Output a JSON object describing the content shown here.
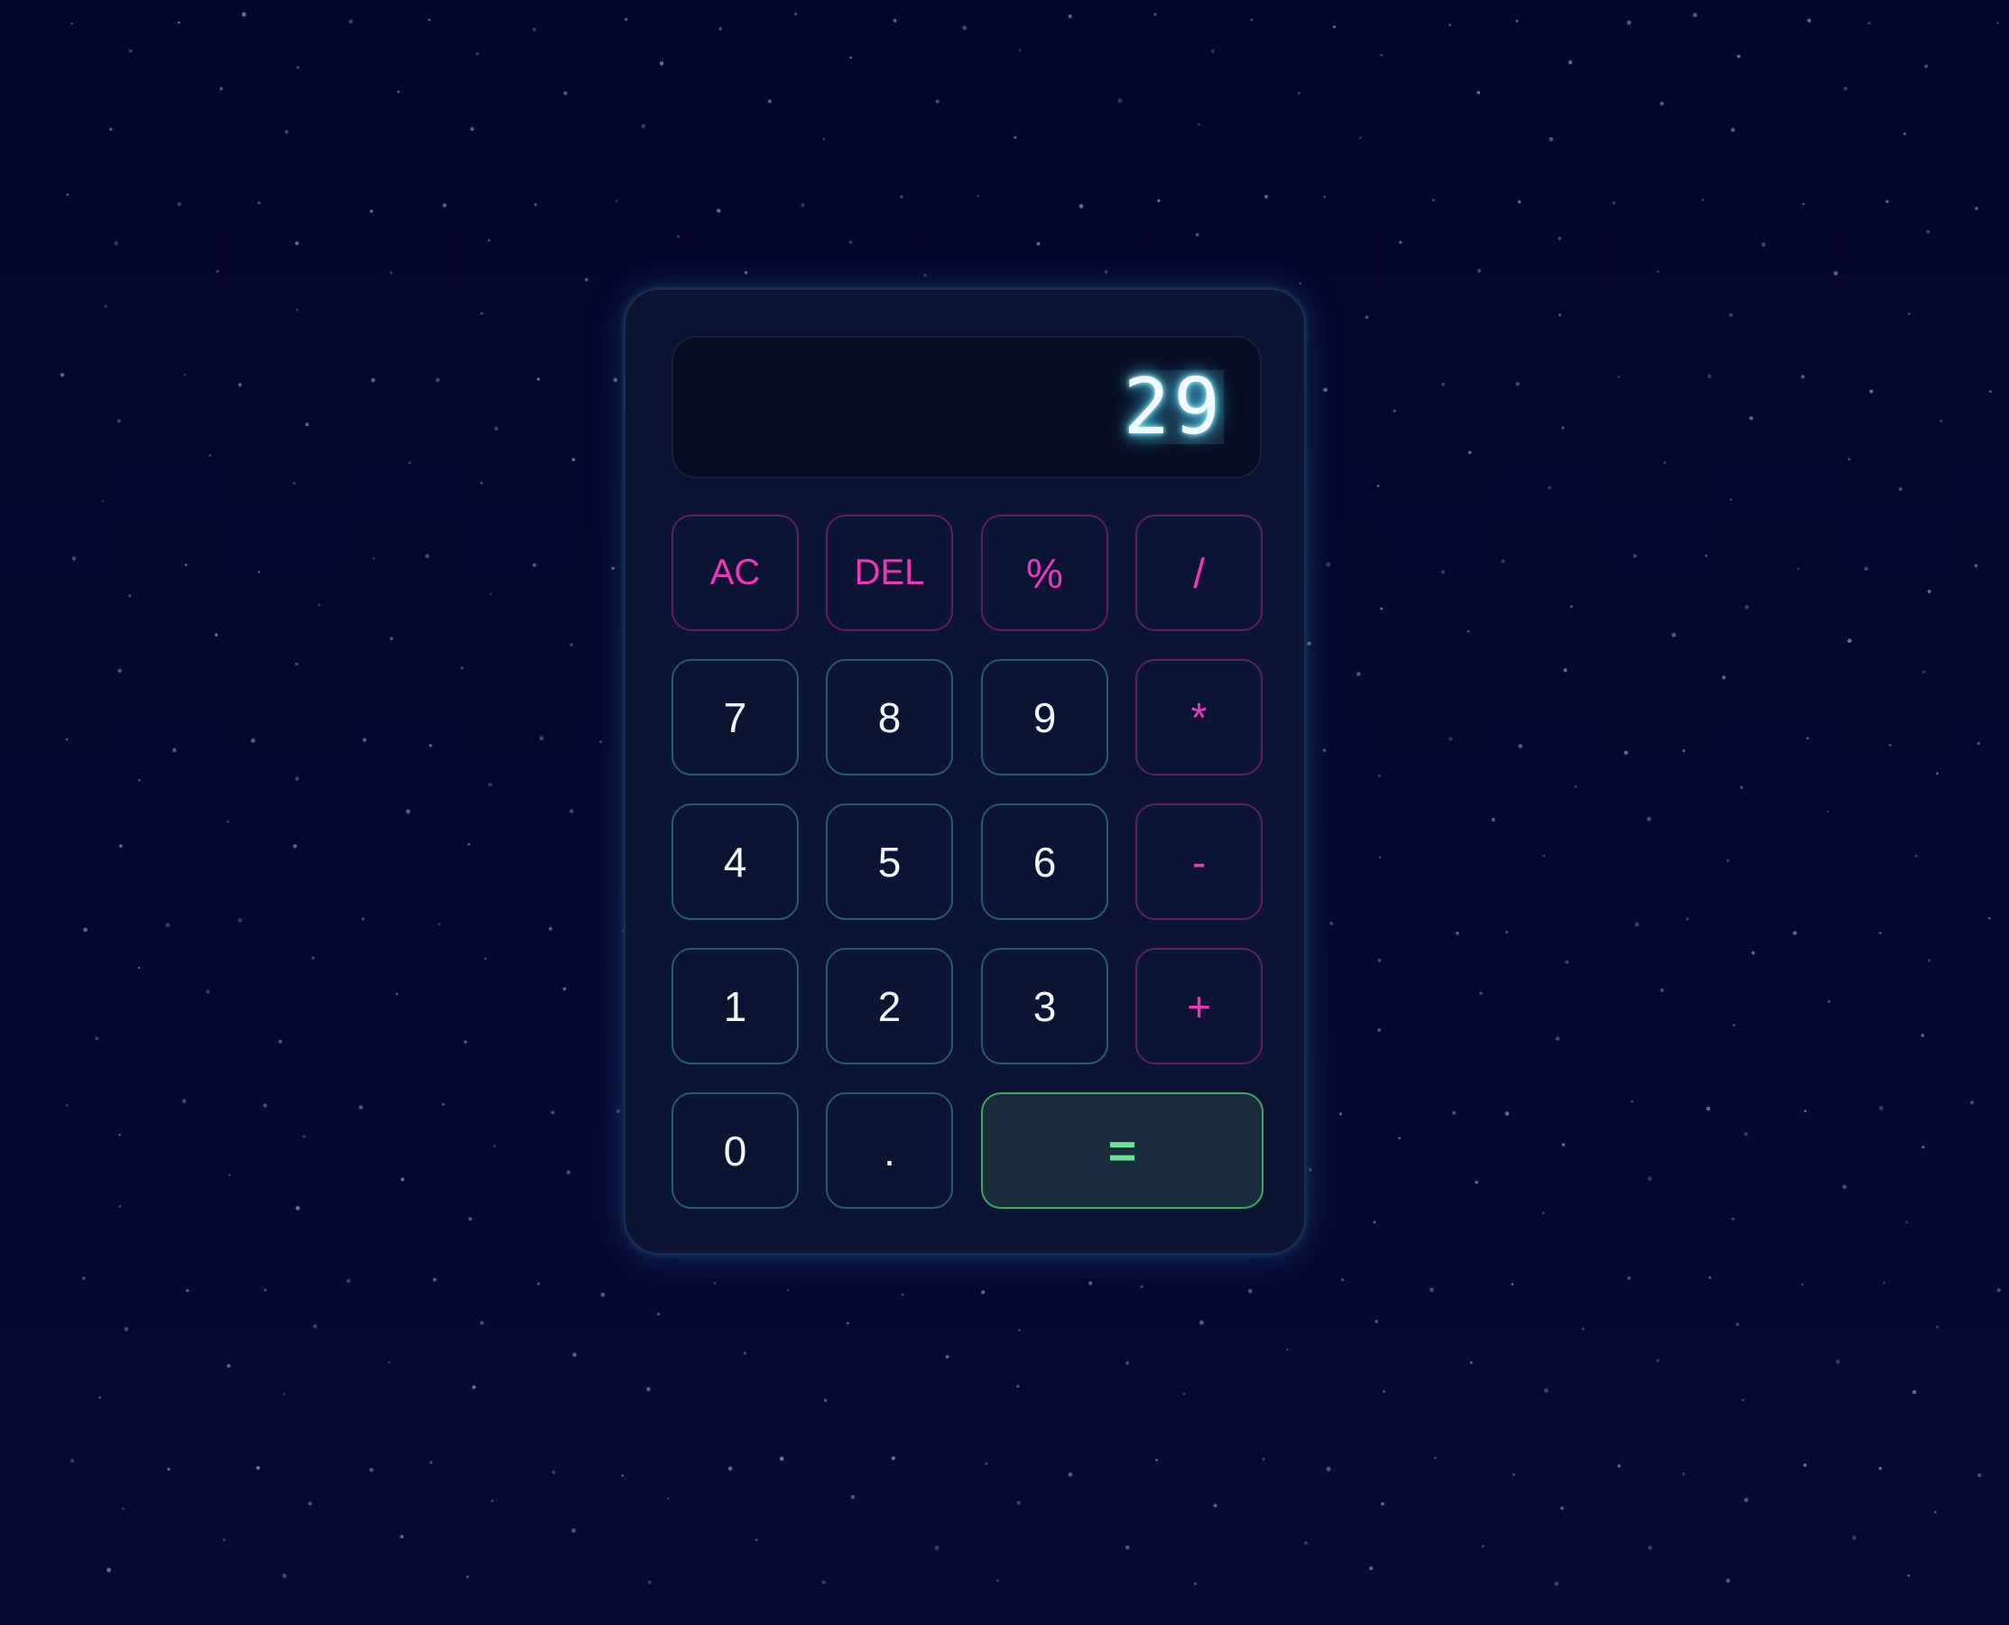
{
  "display": {
    "value": "29",
    "glow_color": "#5fd8ff"
  },
  "colors": {
    "background": "#05062b",
    "number_border": "#2b5a6e",
    "operator_text": "#ec38b6",
    "operator_border": "#5c1f5f",
    "equals_text": "#6ee29a",
    "equals_border": "#3ea869"
  },
  "buttons": {
    "ac": "AC",
    "del": "DEL",
    "percent": "%",
    "divide": "/",
    "seven": "7",
    "eight": "8",
    "nine": "9",
    "multiply": "*",
    "four": "4",
    "five": "5",
    "six": "6",
    "subtract": "-",
    "one": "1",
    "two": "2",
    "three": "3",
    "add": "+",
    "zero": "0",
    "decimal": ".",
    "equals": "="
  }
}
